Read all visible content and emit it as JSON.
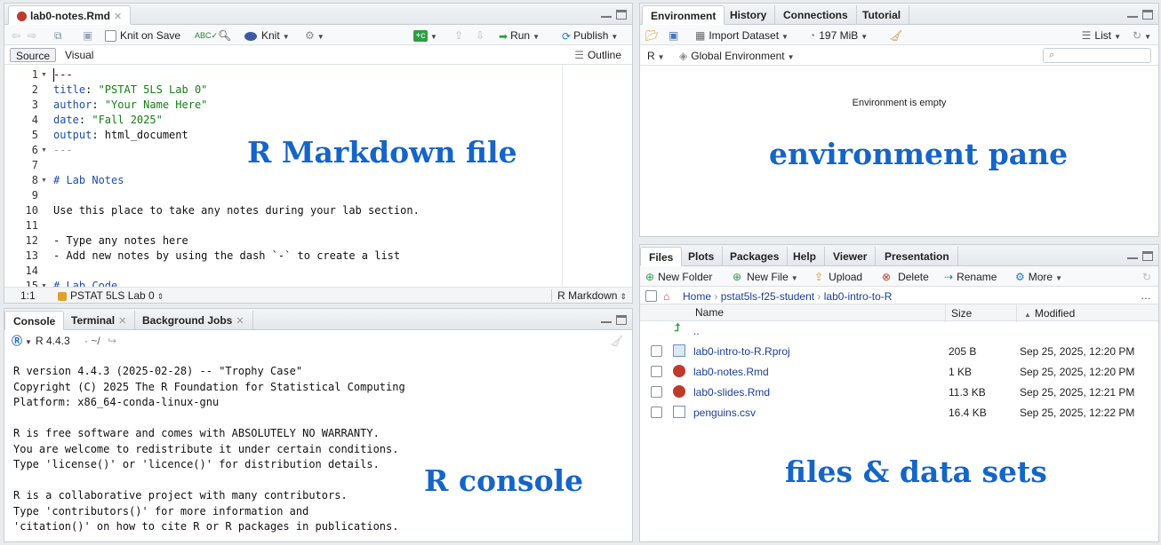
{
  "colors": {
    "accent": "#1565c8",
    "link": "#1a3e9c",
    "string": "#177d17",
    "keyword": "#1f4ea8"
  },
  "editor": {
    "tab_label": "lab0-notes.Rmd",
    "knit_on_save_label": "Knit on Save",
    "knit_label": "Knit",
    "run_label": "Run",
    "publish_label": "Publish",
    "source_label": "Source",
    "visual_label": "Visual",
    "outline_label": "Outline",
    "overlay_label": "R Markdown file",
    "status_position": "1:1",
    "status_section": "PSTAT 5LS Lab 0",
    "status_mode": "R Markdown",
    "lines": [
      {
        "n": "1",
        "fold": true,
        "parts": [
          {
            "t": "---",
            "c": "plain"
          }
        ]
      },
      {
        "n": "2",
        "fold": false,
        "parts": [
          {
            "t": "title",
            "c": "kw"
          },
          {
            "t": ": ",
            "c": "plain"
          },
          {
            "t": "\"PSTAT 5LS Lab 0\"",
            "c": "str"
          }
        ]
      },
      {
        "n": "3",
        "fold": false,
        "parts": [
          {
            "t": "author",
            "c": "kw"
          },
          {
            "t": ": ",
            "c": "plain"
          },
          {
            "t": "\"Your Name Here\"",
            "c": "str"
          }
        ]
      },
      {
        "n": "4",
        "fold": false,
        "parts": [
          {
            "t": "date",
            "c": "kw"
          },
          {
            "t": ": ",
            "c": "plain"
          },
          {
            "t": "\"Fall 2025\"",
            "c": "str"
          }
        ]
      },
      {
        "n": "5",
        "fold": false,
        "parts": [
          {
            "t": "output",
            "c": "kw"
          },
          {
            "t": ": html_document",
            "c": "plain"
          }
        ]
      },
      {
        "n": "6",
        "fold": true,
        "parts": [
          {
            "t": "---",
            "c": "muted"
          }
        ]
      },
      {
        "n": "7",
        "fold": false,
        "parts": [
          {
            "t": "",
            "c": "plain"
          }
        ]
      },
      {
        "n": "8",
        "fold": true,
        "parts": [
          {
            "t": "# Lab Notes",
            "c": "kw"
          }
        ]
      },
      {
        "n": "9",
        "fold": false,
        "parts": [
          {
            "t": "",
            "c": "plain"
          }
        ]
      },
      {
        "n": "10",
        "fold": false,
        "parts": [
          {
            "t": "Use this place to take any notes during your lab section.",
            "c": "plain"
          }
        ]
      },
      {
        "n": "11",
        "fold": false,
        "parts": [
          {
            "t": "",
            "c": "plain"
          }
        ]
      },
      {
        "n": "12",
        "fold": false,
        "parts": [
          {
            "t": "- Type any notes here",
            "c": "plain"
          }
        ]
      },
      {
        "n": "13",
        "fold": false,
        "parts": [
          {
            "t": "- Add new notes by using the dash `-` to create a list",
            "c": "plain"
          }
        ]
      },
      {
        "n": "14",
        "fold": false,
        "parts": [
          {
            "t": "",
            "c": "plain"
          }
        ]
      },
      {
        "n": "15",
        "fold": true,
        "parts": [
          {
            "t": "# Lab Code",
            "c": "kw"
          }
        ]
      }
    ]
  },
  "console": {
    "tabs": [
      "Console",
      "Terminal",
      "Background Jobs"
    ],
    "r_version": "R 4.4.3",
    "working_dir": "· ~/",
    "overlay_label": "R console",
    "lines": [
      "R version 4.4.3 (2025-02-28) -- \"Trophy Case\"",
      "Copyright (C) 2025 The R Foundation for Statistical Computing",
      "Platform: x86_64-conda-linux-gnu",
      "",
      "R is free software and comes with ABSOLUTELY NO WARRANTY.",
      "You are welcome to redistribute it under certain conditions.",
      "Type 'license()' or 'licence()' for distribution details.",
      "",
      "R is a collaborative project with many contributors.",
      "Type 'contributors()' for more information and",
      "'citation()' on how to cite R or R packages in publications."
    ]
  },
  "environment": {
    "tabs": [
      "Environment",
      "History",
      "Connections",
      "Tutorial"
    ],
    "import_label": "Import Dataset",
    "memory_label": "197 MiB",
    "list_label": "List",
    "lang_label": "R",
    "scope_label": "Global Environment",
    "empty_label": "Environment is empty",
    "overlay_label": "environment pane"
  },
  "files": {
    "tabs": [
      "Files",
      "Plots",
      "Packages",
      "Help",
      "Viewer",
      "Presentation"
    ],
    "new_folder_label": "New Folder",
    "new_file_label": "New File",
    "upload_label": "Upload",
    "delete_label": "Delete",
    "rename_label": "Rename",
    "more_label": "More",
    "breadcrumb": [
      "Home",
      "pstat5ls-f25-student",
      "lab0-intro-to-R"
    ],
    "col_name": "Name",
    "col_size": "Size",
    "col_modified": "Modified",
    "parent_label": "..",
    "overlay_label": "files & data sets",
    "rows": [
      {
        "name": "lab0-intro-to-R.Rproj",
        "size": "205 B",
        "modified": "Sep 25, 2025, 12:20 PM",
        "icon": "rproj-icon"
      },
      {
        "name": "lab0-notes.Rmd",
        "size": "1 KB",
        "modified": "Sep 25, 2025, 12:20 PM",
        "icon": "rmd-icon"
      },
      {
        "name": "lab0-slides.Rmd",
        "size": "11.3 KB",
        "modified": "Sep 25, 2025, 12:21 PM",
        "icon": "rmd-icon"
      },
      {
        "name": "penguins.csv",
        "size": "16.4 KB",
        "modified": "Sep 25, 2025, 12:22 PM",
        "icon": "csv-icon"
      }
    ]
  }
}
